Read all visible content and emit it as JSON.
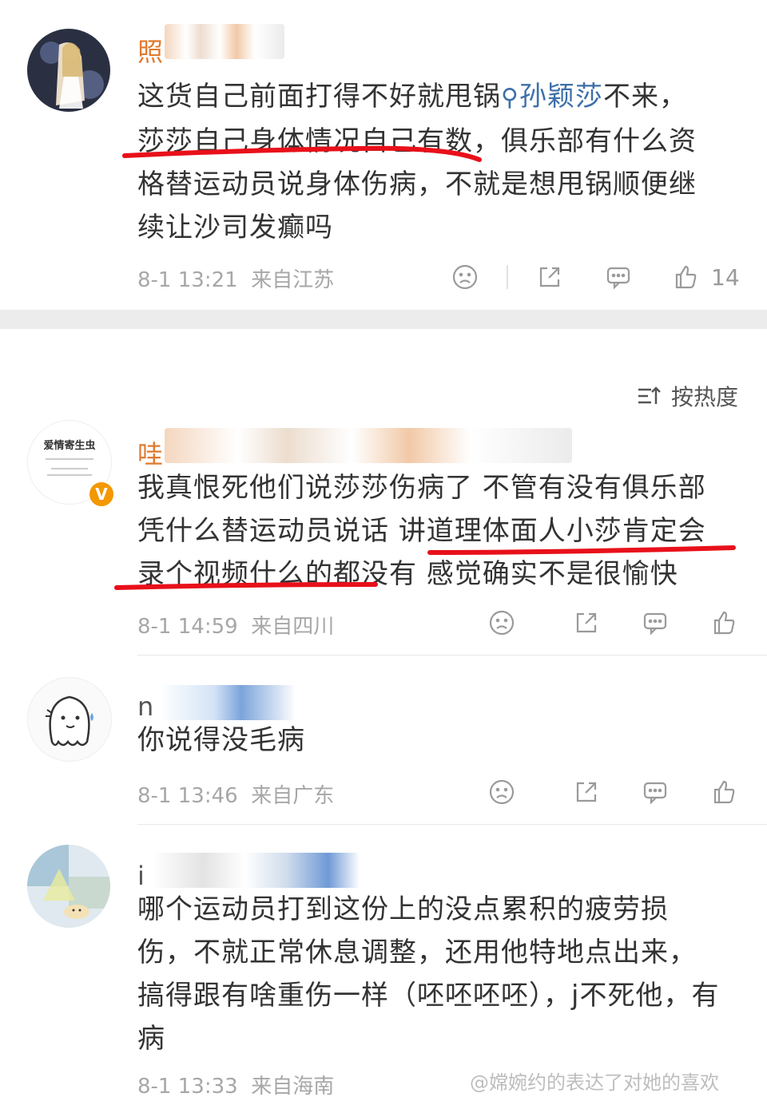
{
  "comments": {
    "c1": {
      "name_prefix": "照",
      "line1_a": "这货自己前面打得不好就甩锅",
      "mention": "孙颖莎",
      "line1_b": "不来，",
      "line2": "莎莎自己身体情况自己有数，俱乐部有什么资",
      "line3": "格替运动员说身体伤病，不就是想甩锅顺便继",
      "line4": "续让沙司发癫吗",
      "time": "8-1 13:21",
      "location": "来自江苏",
      "likes": "14"
    },
    "c2": {
      "name_prefix": "哇",
      "avatar_text": "爱情寄生虫",
      "vip_badge": "V",
      "line1": "我真恨死他们说莎莎伤病了 不管有没有俱乐部",
      "line2": "凭什么替运动员说话 讲道理体面人小莎肯定会",
      "line3": "录个视频什么的都没有 感觉确实不是很愉快",
      "time": "8-1 14:59",
      "location": "来自四川"
    },
    "c3": {
      "name_prefix": "n",
      "line1": "你说得没毛病",
      "time": "8-1 13:46",
      "location": "来自广东"
    },
    "c4": {
      "name_prefix": "i",
      "line1": "哪个运动员打到这份上的没点累积的疲劳损",
      "line2": "伤，不就正常休息调整，还用他特地点出来，",
      "line3": "搞得跟有啥重伤一样（呸呸呸呸），j不死他，有",
      "line4": "病",
      "time": "8-1 13:33",
      "location": "来自海南"
    }
  },
  "sort_label": "按热度",
  "watermark": "@嫦婉约的表达了对她的喜欢",
  "icons": [
    "sad-face-icon",
    "share-icon",
    "comment-icon",
    "thumbs-up-icon",
    "search-icon",
    "sort-icon"
  ],
  "colors": {
    "mention": "#3d6fa8",
    "underline": "#e8101a",
    "vip": "#f39800"
  }
}
